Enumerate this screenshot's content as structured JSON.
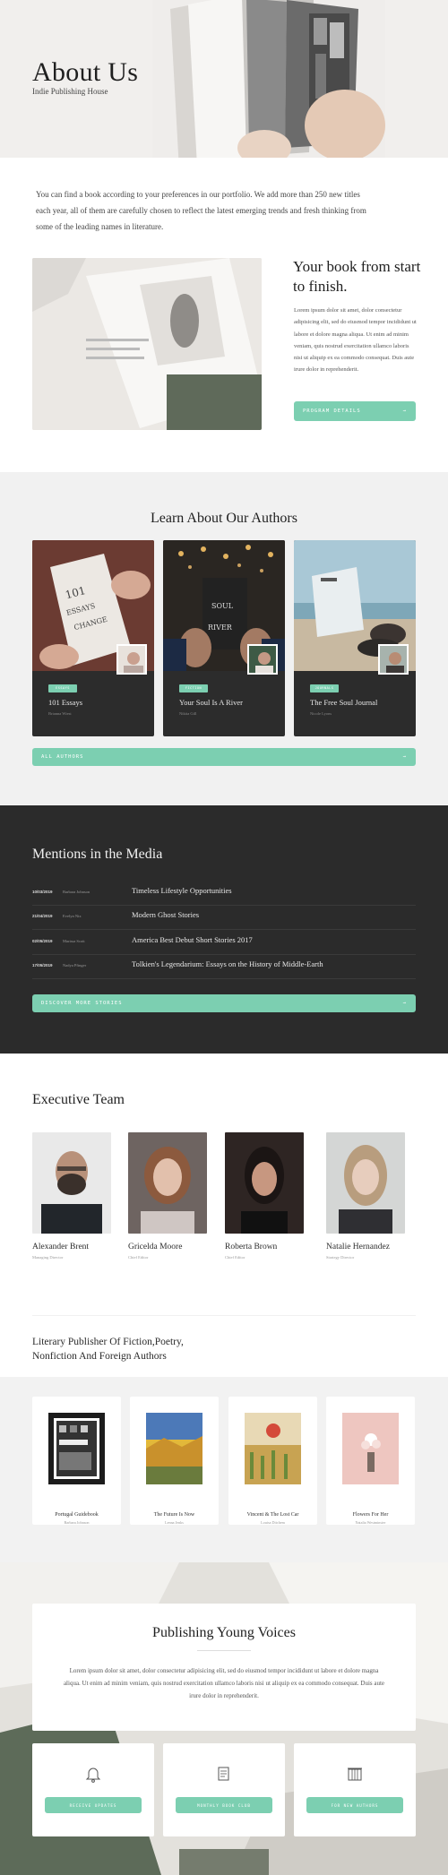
{
  "hero": {
    "title": "About Us",
    "subtitle": "Indie Publishing House"
  },
  "intro": {
    "text": "You can find a book according to your preferences in our portfolio. We add more than 250 new titles each year, all of them are carefully chosen to reflect the latest emerging trends and fresh thinking from some of the leading names in literature."
  },
  "feature": {
    "title": "Your book from start to finish.",
    "body": "Lorem ipsum dolor sit amet, dolor consectetur adipisicing elit, sed do eiusmod tempor incididunt ut labore et dolore magna aliqua. Ut enim ad minim veniam, quis nostrud exercitation ullamco laboris nisi ut aliquip ex ea commodo consequat. Duis aute irure dolor in reprehenderit.",
    "button_label": "PROGRAM DETAILS",
    "button_arrow": "→"
  },
  "authors": {
    "title": "Learn About Our Authors",
    "cards": [
      {
        "badge": "ESSAYS",
        "title": "101 Essays",
        "author": "Brianna Wiest"
      },
      {
        "badge": "FICTION",
        "title": "Your Soul Is A River",
        "author": "Nikita Gill"
      },
      {
        "badge": "JOURNALS",
        "title": "The Free Soul Journal",
        "author": "Nicole Lyons"
      }
    ],
    "button_label": "ALL AUTHORS",
    "button_arrow": "→"
  },
  "media": {
    "title": "Mentions in the Media",
    "rows": [
      {
        "date": "10/03/2019",
        "author": "Barbara Johnson",
        "headline": "Timeless Lifestyle Opportunities"
      },
      {
        "date": "21/04/2019",
        "author": "Evelyn Nix",
        "headline": "Modern Ghost Stories"
      },
      {
        "date": "02/05/2019",
        "author": "Marissa Scott",
        "headline": "America Best Debut Short Stories 2017"
      },
      {
        "date": "17/05/2019",
        "author": "Nadya Pfinger",
        "headline": "Tolkien's Legendarium: Essays on the History of Middle-Earth"
      }
    ],
    "button_label": "DISCOVER MORE STORIES",
    "button_arrow": "→"
  },
  "executive": {
    "title": "Executive Team",
    "members": [
      {
        "name": "Alexander Brent",
        "role": "Managing Director"
      },
      {
        "name": "Gricelda Moore",
        "role": "Chief Editor"
      },
      {
        "name": "Roberta Brown",
        "role": "Chief Editor"
      },
      {
        "name": "Natalie Hernandez",
        "role": "Strategy Director"
      }
    ]
  },
  "literary": {
    "title": "Literary Publisher Of Fiction,Poetry, Nonfiction And Foreign Authors",
    "books": [
      {
        "title": "Portugal Guidebook",
        "author": "Barbara Johnson"
      },
      {
        "title": "The Future Is Now",
        "author": "Lenna Jenks"
      },
      {
        "title": "Vincent & The Lost Car",
        "author": "Louisa Ditchem"
      },
      {
        "title": "Flowers For Her",
        "author": "Natalia Westminster"
      }
    ]
  },
  "young": {
    "title": "Publishing Young Voices",
    "text": "Lorem ipsum dolor sit amet, dolor consectetur adipisicing elit, sed do eiusmod tempor incididunt ut labore et dolore magna aliqua. Ut enim ad minim veniam, quis nostrud exercitation ullamco laboris nisi ut aliquip ex ea commodo consequat. Duis aute irure dolor in reprehenderit.",
    "ctas": [
      {
        "icon": "bell-icon",
        "label": "RECEIVE UPDATES"
      },
      {
        "icon": "scroll-icon",
        "label": "MONTHLY BOOK CLUB"
      },
      {
        "icon": "building-icon",
        "label": "FOR NEW AUTHORS"
      }
    ]
  },
  "colors": {
    "accent": "#7ccfb1",
    "dark": "#2b2b2b",
    "light_band": "#f1f1f1"
  }
}
